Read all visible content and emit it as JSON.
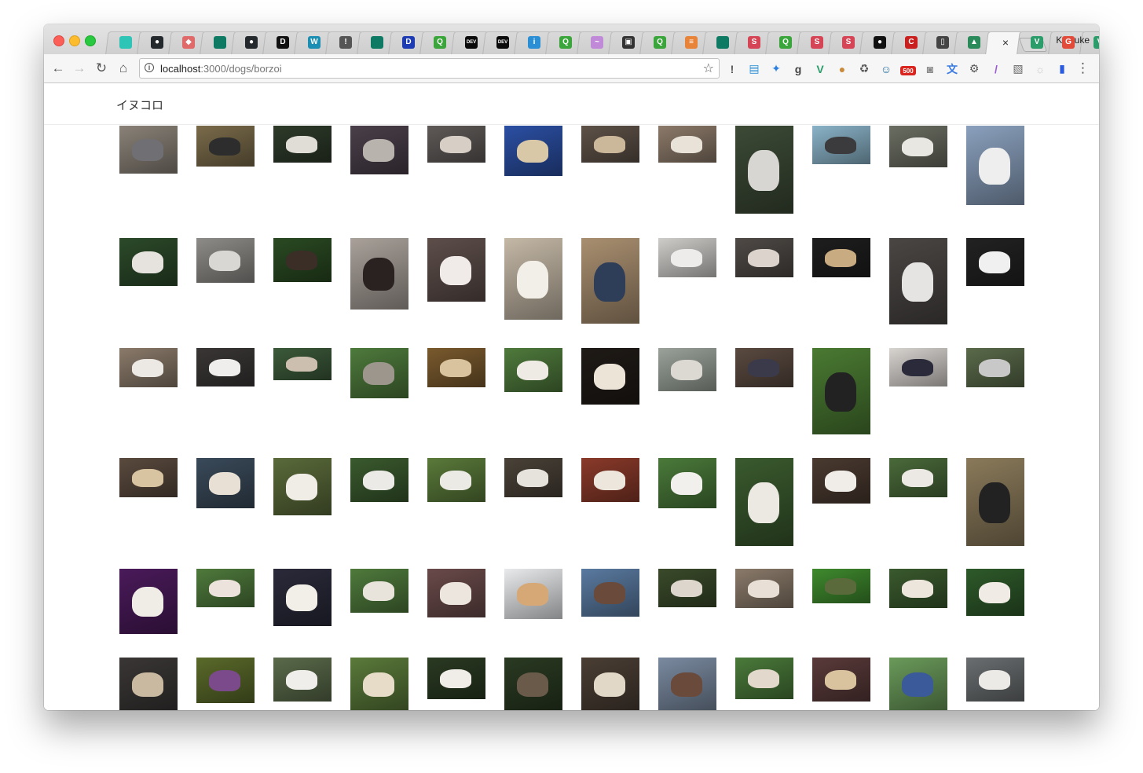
{
  "browser": {
    "profile_name": "Keisuke",
    "url_host": "localhost",
    "url_path": ":3000/dogs/borzoi",
    "active_tab_close": "×",
    "tabs": [
      {
        "icon": "cyan-square-icon",
        "color": "#2ec4b6",
        "glyph": ""
      },
      {
        "icon": "github-icon",
        "color": "#24292e",
        "glyph": "●"
      },
      {
        "icon": "fox-icon",
        "color": "#e06a6a",
        "glyph": "◆"
      },
      {
        "icon": "teal-box-icon",
        "color": "#0e7a63",
        "glyph": ""
      },
      {
        "icon": "github-icon",
        "color": "#24292e",
        "glyph": "●"
      },
      {
        "icon": "d-logo-icon",
        "color": "#111111",
        "glyph": "D"
      },
      {
        "icon": "w-logo-icon",
        "color": "#1a8fb3",
        "glyph": "W"
      },
      {
        "icon": "circle-info-icon",
        "color": "#555555",
        "glyph": "!"
      },
      {
        "icon": "teal-box-icon",
        "color": "#0e7a63",
        "glyph": ""
      },
      {
        "icon": "d-blue-icon",
        "color": "#1d3bb3",
        "glyph": "D"
      },
      {
        "icon": "q-green-icon",
        "color": "#3aa53a",
        "glyph": "Q"
      },
      {
        "icon": "dev-icon",
        "color": "#0a0a0a",
        "glyph": "DEV"
      },
      {
        "icon": "dev-icon",
        "color": "#0a0a0a",
        "glyph": "DEV"
      },
      {
        "icon": "info-blue-icon",
        "color": "#2b8fd6",
        "glyph": "i"
      },
      {
        "icon": "q-green-icon",
        "color": "#3aa53a",
        "glyph": "Q"
      },
      {
        "icon": "wave-icon",
        "color": "#c08ad8",
        "glyph": "~"
      },
      {
        "icon": "gameboy-icon",
        "color": "#333333",
        "glyph": "▣"
      },
      {
        "icon": "q-green-icon",
        "color": "#3aa53a",
        "glyph": "Q"
      },
      {
        "icon": "stack-icon",
        "color": "#e8843a",
        "glyph": "≡"
      },
      {
        "icon": "teal-box-icon",
        "color": "#0e7a63",
        "glyph": ""
      },
      {
        "icon": "s-red-icon",
        "color": "#d64555",
        "glyph": "S"
      },
      {
        "icon": "q-green-icon",
        "color": "#3aa53a",
        "glyph": "Q"
      },
      {
        "icon": "s-red-icon",
        "color": "#d64555",
        "glyph": "S"
      },
      {
        "icon": "s-red-icon",
        "color": "#d64555",
        "glyph": "S"
      },
      {
        "icon": "dog-face-icon",
        "color": "#111111",
        "glyph": "●"
      },
      {
        "icon": "c-red-icon",
        "color": "#c91f1f",
        "glyph": "C"
      },
      {
        "icon": "book-icon",
        "color": "#444444",
        "glyph": "▯"
      },
      {
        "icon": "triangle-icon",
        "color": "#2a8a5a",
        "glyph": "▲"
      },
      {
        "icon": "close-icon",
        "color": "",
        "glyph": "×"
      },
      {
        "icon": "vue-icon",
        "color": "#2a9d6a",
        "glyph": "V"
      },
      {
        "icon": "google-icon",
        "color": "#e24a3a",
        "glyph": "G"
      },
      {
        "icon": "vue-icon",
        "color": "#2a9d6a",
        "glyph": "V"
      }
    ],
    "extensions": [
      {
        "icon": "onepassword-icon",
        "color": "#555555",
        "glyph": "!"
      },
      {
        "icon": "screenshot-icon",
        "color": "#2a8fd6",
        "glyph": "▤"
      },
      {
        "icon": "compass-icon",
        "color": "#2a7fe0",
        "glyph": "✦"
      },
      {
        "icon": "grammarly-icon",
        "color": "#444444",
        "glyph": "g"
      },
      {
        "icon": "vue-devtools-icon",
        "color": "#2a9d6a",
        "glyph": "V"
      },
      {
        "icon": "cookie-icon",
        "color": "#c98a3a",
        "glyph": "●"
      },
      {
        "icon": "recycle-icon",
        "color": "#555555",
        "glyph": "♻"
      },
      {
        "icon": "octopus-icon",
        "color": "#2a6fa0",
        "glyph": "☺"
      },
      {
        "icon": "badge-500-icon",
        "color": "#d9251e",
        "glyph": "500"
      },
      {
        "icon": "camera-icon",
        "color": "#888888",
        "glyph": "◙"
      },
      {
        "icon": "translate-icon",
        "color": "#3a7ae0",
        "glyph": "文"
      },
      {
        "icon": "gear-icon",
        "color": "#555555",
        "glyph": "⚙"
      },
      {
        "icon": "feather-icon",
        "color": "#9a5ad8",
        "glyph": "/"
      },
      {
        "icon": "image-icon",
        "color": "#666666",
        "glyph": "▧"
      },
      {
        "icon": "sun-icon",
        "color": "#cccccc",
        "glyph": "☼"
      },
      {
        "icon": "flag-icon",
        "color": "#2a5ae0",
        "glyph": "▮"
      }
    ]
  },
  "site": {
    "title": "イヌコロ"
  },
  "gallery": {
    "rows": [
      [
        {
          "h": 0.82,
          "bg": "#8a8278",
          "dog": "#6f6f74"
        },
        {
          "h": 0.7,
          "bg": "#7a6b4a",
          "dog": "#2d2d2d"
        },
        {
          "h": 0.64,
          "bg": "#2e3a2a",
          "dog": "#e0ddd6"
        },
        {
          "h": 0.84,
          "bg": "#4a3f4a",
          "dog": "#b9b3ad"
        },
        {
          "h": 0.64,
          "bg": "#5f5a58",
          "dog": "#d7cfc6"
        },
        {
          "h": 0.87,
          "bg": "#2b4fa3",
          "dog": "#d9c8a8"
        },
        {
          "h": 0.64,
          "bg": "#5e5248",
          "dog": "#cbb79a"
        },
        {
          "h": 0.64,
          "bg": "#8c7a6a",
          "dog": "#e8e2d8"
        },
        {
          "h": 1.52,
          "bg": "#3c4a36",
          "dog": "#d8d6d2"
        },
        {
          "h": 0.66,
          "bg": "#8ab3c8",
          "dog": "#3b3b3e"
        },
        {
          "h": 0.72,
          "bg": "#6b6e62",
          "dog": "#e9e7e2"
        },
        {
          "h": 1.36,
          "bg": "#8aa0bd",
          "dog": "#eeeeee"
        }
      ],
      [
        {
          "h": 0.82,
          "bg": "#2c4a2a",
          "dog": "#e6e2de"
        },
        {
          "h": 0.77,
          "bg": "#8e8c88",
          "dog": "#d9d7d3"
        },
        {
          "h": 0.75,
          "bg": "#2a4a22",
          "dog": "#3a2e26"
        },
        {
          "h": 1.23,
          "bg": "#a9a19a",
          "dog": "#2a2220"
        },
        {
          "h": 1.1,
          "bg": "#5d4e4a",
          "dog": "#f0ebe8"
        },
        {
          "h": 1.41,
          "bg": "#c4b8a6",
          "dog": "#f2efe8"
        },
        {
          "h": 1.47,
          "bg": "#a98f70",
          "dog": "#2f3e58"
        },
        {
          "h": 0.68,
          "bg": "#cfcdca",
          "dog": "#eeecea"
        },
        {
          "h": 0.67,
          "bg": "#4f4a46",
          "dog": "#dcd4cc"
        },
        {
          "h": 0.67,
          "bg": "#1e1e1e",
          "dog": "#c8ab80"
        },
        {
          "h": 1.49,
          "bg": "#4a4644",
          "dog": "#e6e4e2"
        },
        {
          "h": 0.82,
          "bg": "#222222",
          "dog": "#f0f0f0"
        }
      ],
      [
        {
          "h": 0.68,
          "bg": "#8a7a6a",
          "dog": "#ece9e4"
        },
        {
          "h": 0.66,
          "bg": "#3a3636",
          "dog": "#f0eeec"
        },
        {
          "h": 0.55,
          "bg": "#3c5a3a",
          "dog": "#cdbfb0"
        },
        {
          "h": 0.87,
          "bg": "#4e7a3c",
          "dog": "#9c968c"
        },
        {
          "h": 0.68,
          "bg": "#7a5a2e",
          "dog": "#d8c39e"
        },
        {
          "h": 0.75,
          "bg": "#4f7a3c",
          "dog": "#eeeae4"
        },
        {
          "h": 0.97,
          "bg": "#1f1a16",
          "dog": "#ece4d6"
        },
        {
          "h": 0.74,
          "bg": "#9aa29a",
          "dog": "#dcd8d2"
        },
        {
          "h": 0.68,
          "bg": "#5a4a40",
          "dog": "#3a3a4a"
        },
        {
          "h": 1.49,
          "bg": "#4a7a32",
          "dog": "#222222"
        },
        {
          "h": 0.66,
          "bg": "#d8d4d0",
          "dog": "#2a2a3a"
        },
        {
          "h": 0.68,
          "bg": "#5a6a4a",
          "dog": "#c8c8c8"
        }
      ],
      [
        {
          "h": 0.67,
          "bg": "#5a4a3e",
          "dog": "#d9c4a2"
        },
        {
          "h": 0.86,
          "bg": "#3a4a5a",
          "dog": "#e8e0d4"
        },
        {
          "h": 0.99,
          "bg": "#5a6a3a",
          "dog": "#f0ece6"
        },
        {
          "h": 0.75,
          "bg": "#3a5a2e",
          "dog": "#eceae6"
        },
        {
          "h": 0.76,
          "bg": "#5a7a3a",
          "dog": "#eceae4"
        },
        {
          "h": 0.67,
          "bg": "#4a4238",
          "dog": "#e6e2dc"
        },
        {
          "h": 0.75,
          "bg": "#8a3a2a",
          "dog": "#ece6dc"
        },
        {
          "h": 0.86,
          "bg": "#4a7a3a",
          "dog": "#f2f0ec"
        },
        {
          "h": 1.51,
          "bg": "#3a5a2e",
          "dog": "#ece8e2"
        },
        {
          "h": 0.79,
          "bg": "#4a3a30",
          "dog": "#f0ece8"
        },
        {
          "h": 0.67,
          "bg": "#4a6a3a",
          "dog": "#ece8e4"
        },
        {
          "h": 1.51,
          "bg": "#8a7a5a",
          "dog": "#222222"
        }
      ],
      [
        {
          "h": 1.12,
          "bg": "#4a1a5a",
          "dog": "#f0ece6"
        },
        {
          "h": 0.66,
          "bg": "#4f7a3c",
          "dog": "#ece4dc"
        },
        {
          "h": 0.99,
          "bg": "#2a2a3a",
          "dog": "#f2efe8"
        },
        {
          "h": 0.75,
          "bg": "#4f7a3c",
          "dog": "#e8e4dc"
        },
        {
          "h": 0.84,
          "bg": "#6a4a4a",
          "dog": "#ece6de"
        },
        {
          "h": 0.87,
          "bg": "#e8eaec",
          "dog": "#d6a876"
        },
        {
          "h": 0.82,
          "bg": "#5a7aa0",
          "dog": "#6a4a3a"
        },
        {
          "h": 0.66,
          "bg": "#3a4a2a",
          "dog": "#dcd6cc"
        },
        {
          "h": 0.68,
          "bg": "#8a7a6a",
          "dog": "#e8e0d6"
        },
        {
          "h": 0.59,
          "bg": "#3f8a2e",
          "dog": "#5a6a3a"
        },
        {
          "h": 0.67,
          "bg": "#3a5a2e",
          "dog": "#ece6dc"
        },
        {
          "h": 0.81,
          "bg": "#2e5a2a",
          "dog": "#f0ebe4"
        }
      ],
      [
        {
          "h": 0.92,
          "bg": "#3a3636",
          "dog": "#c8b9a0"
        },
        {
          "h": 0.78,
          "bg": "#5a6a2a",
          "dog": "#7a4a8a"
        },
        {
          "h": 0.75,
          "bg": "#5a6a4a",
          "dog": "#f0eeea"
        },
        {
          "h": 0.9,
          "bg": "#5a7a3a",
          "dog": "#e6dcc8"
        },
        {
          "h": 0.72,
          "bg": "#2a3a22",
          "dog": "#f0ece8"
        },
        {
          "h": 0.92,
          "bg": "#2a3a22",
          "dog": "#6a5a4a"
        },
        {
          "h": 0.92,
          "bg": "#4a3e34",
          "dog": "#e2d8c8"
        },
        {
          "h": 0.92,
          "bg": "#7a8aa0",
          "dog": "#6a4a3a"
        },
        {
          "h": 0.72,
          "bg": "#4a7a3a",
          "dog": "#e2d8cc"
        },
        {
          "h": 0.75,
          "bg": "#5a3a3a",
          "dog": "#d9c29e"
        },
        {
          "h": 0.92,
          "bg": "#6a9a5a",
          "dog": "#3a5a9a"
        },
        {
          "h": 0.75,
          "bg": "#6a6e70",
          "dog": "#eceae6"
        }
      ]
    ]
  }
}
